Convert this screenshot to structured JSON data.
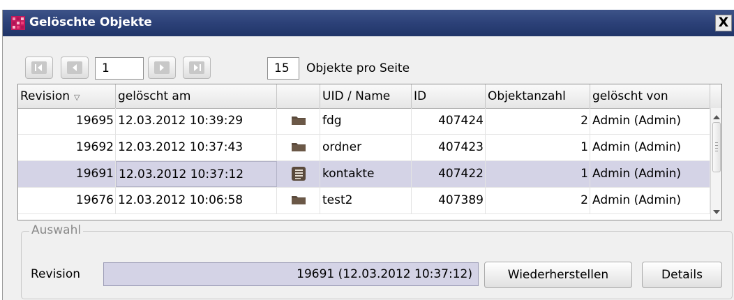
{
  "window": {
    "title": "Gelöschte Objekte",
    "close_label": "X"
  },
  "pager": {
    "page": "1",
    "per_page_value": "15",
    "per_page_label": "Objekte pro Seite"
  },
  "table": {
    "columns": [
      "Revision",
      "gelöscht am",
      "",
      "UID / Name",
      "ID",
      "Objektanzahl",
      "gelöscht von"
    ],
    "sorted_column": "Revision",
    "rows": [
      {
        "revision": "19695",
        "date": "12.03.2012 10:39:29",
        "icon": "folder-icon",
        "name": "fdg",
        "id": "407424",
        "count": "2",
        "by": "Admin (Admin)"
      },
      {
        "revision": "19692",
        "date": "12.03.2012 10:37:43",
        "icon": "folder-icon",
        "name": "ordner",
        "id": "407423",
        "count": "1",
        "by": "Admin (Admin)"
      },
      {
        "revision": "19691",
        "date": "12.03.2012 10:37:12",
        "icon": "document-list-icon",
        "name": "kontakte",
        "id": "407422",
        "count": "1",
        "by": "Admin (Admin)",
        "selected": true
      },
      {
        "revision": "19676",
        "date": "12.03.2012 10:06:58",
        "icon": "folder-icon",
        "name": "test2",
        "id": "407389",
        "count": "2",
        "by": "Admin (Admin)"
      }
    ]
  },
  "selection": {
    "legend": "Auswahl",
    "revision_label": "Revision",
    "revision_value": "19691 (12.03.2012 10:37:12)",
    "restore_button": "Wiederherstellen",
    "details_button": "Details"
  },
  "colors": {
    "title_bar": "#2c4178",
    "selection": "#d4d3e6",
    "folder": "#5a4a3c"
  }
}
